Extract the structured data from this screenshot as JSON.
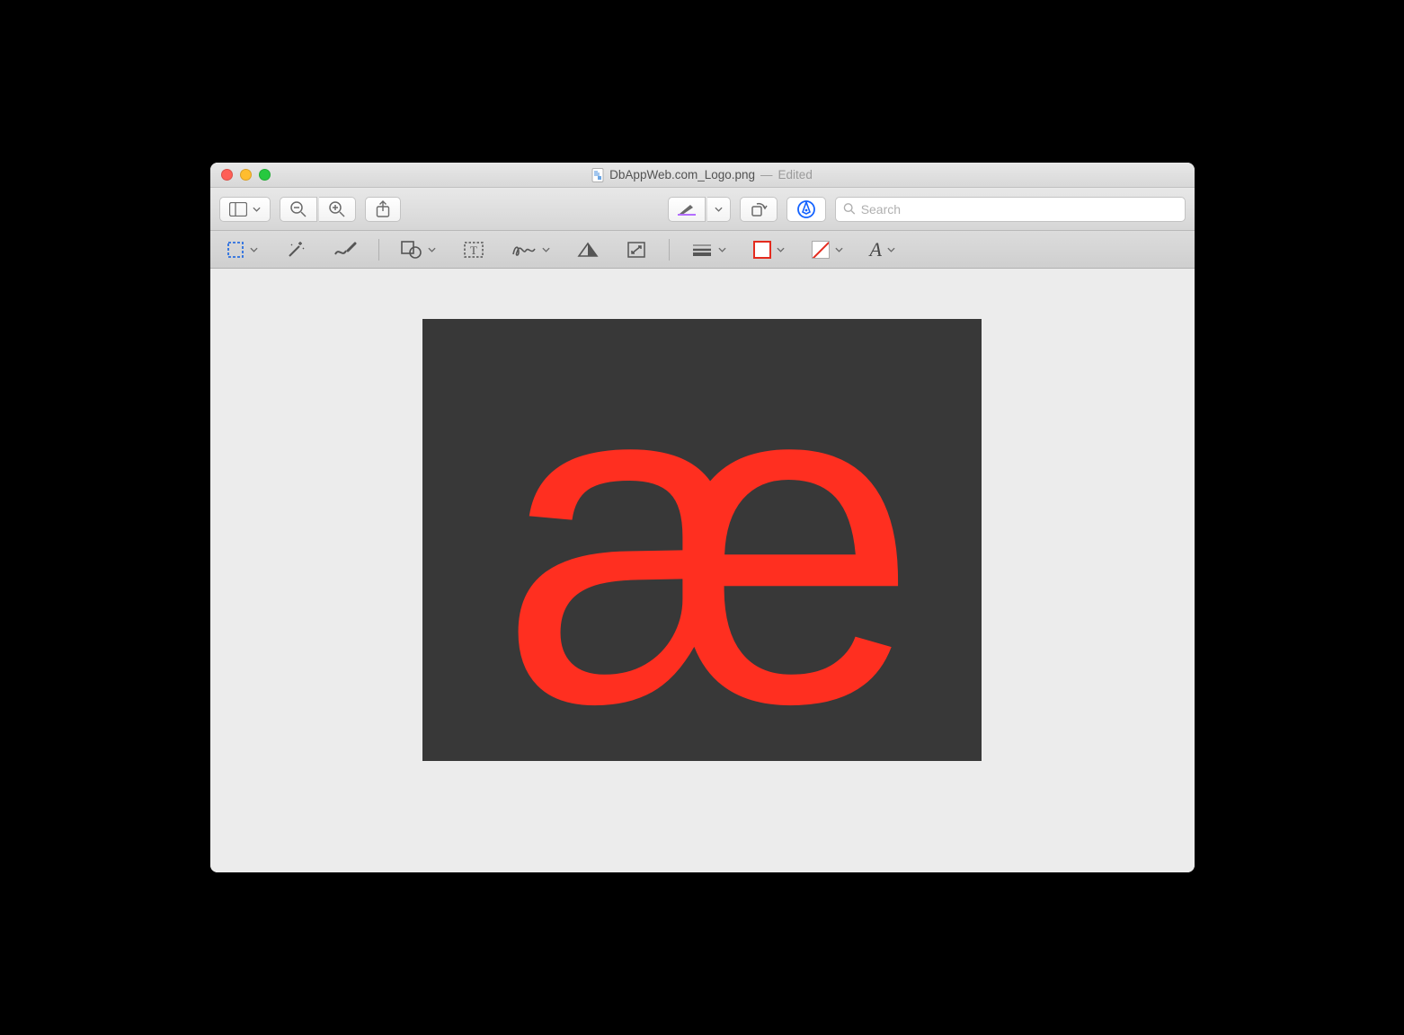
{
  "title": {
    "filename": "DbAppWeb.com_Logo.png",
    "state": "Edited",
    "separator": "—"
  },
  "toolbar": {
    "search_placeholder": "Search"
  },
  "markup": {
    "border_color": "#e42b1e",
    "fill": "none",
    "text_style_glyph": "A"
  },
  "content": {
    "glyph": "æ",
    "bg": "#383838",
    "fg": "#ff2f20"
  }
}
